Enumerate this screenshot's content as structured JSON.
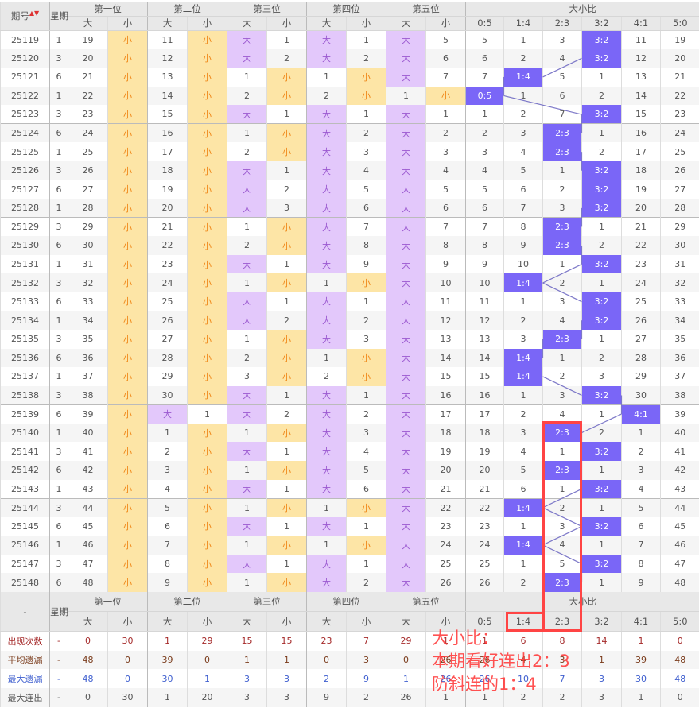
{
  "header": {
    "issue": "期号",
    "sort_icon": "sort-arrows",
    "weekday": "星期",
    "positions": [
      "第一位",
      "第二位",
      "第三位",
      "第四位",
      "第五位"
    ],
    "big": "大",
    "small": "小",
    "ratio_title": "大小比",
    "ratios": [
      "0:5",
      "1:4",
      "2:3",
      "3:2",
      "4:1",
      "5:0"
    ]
  },
  "rows": [
    [
      "25119",
      "1",
      "19",
      "小",
      "11",
      "小",
      "大",
      "1",
      "大",
      "1",
      "大",
      "5",
      "5",
      "1",
      "3",
      "3:2",
      "11",
      "19"
    ],
    [
      "25120",
      "3",
      "20",
      "小",
      "12",
      "小",
      "大",
      "2",
      "大",
      "2",
      "大",
      "6",
      "6",
      "2",
      "4",
      "3:2",
      "12",
      "20"
    ],
    [
      "25121",
      "6",
      "21",
      "小",
      "13",
      "小",
      "1",
      "小",
      "1",
      "小",
      "大",
      "7",
      "7",
      "1:4",
      "5",
      "1",
      "13",
      "21"
    ],
    [
      "25122",
      "1",
      "22",
      "小",
      "14",
      "小",
      "2",
      "小",
      "2",
      "小",
      "1",
      "小",
      "0:5",
      "1",
      "6",
      "2",
      "14",
      "22"
    ],
    [
      "25123",
      "3",
      "23",
      "小",
      "15",
      "小",
      "大",
      "1",
      "大",
      "1",
      "大",
      "1",
      "1",
      "2",
      "7",
      "3:2",
      "15",
      "23"
    ],
    [
      "25124",
      "6",
      "24",
      "小",
      "16",
      "小",
      "1",
      "小",
      "大",
      "2",
      "大",
      "2",
      "2",
      "3",
      "2:3",
      "1",
      "16",
      "24"
    ],
    [
      "25125",
      "1",
      "25",
      "小",
      "17",
      "小",
      "2",
      "小",
      "大",
      "3",
      "大",
      "3",
      "3",
      "4",
      "2:3",
      "2",
      "17",
      "25"
    ],
    [
      "25126",
      "3",
      "26",
      "小",
      "18",
      "小",
      "大",
      "1",
      "大",
      "4",
      "大",
      "4",
      "4",
      "5",
      "1",
      "3:2",
      "18",
      "26"
    ],
    [
      "25127",
      "6",
      "27",
      "小",
      "19",
      "小",
      "大",
      "2",
      "大",
      "5",
      "大",
      "5",
      "5",
      "6",
      "2",
      "3:2",
      "19",
      "27"
    ],
    [
      "25128",
      "1",
      "28",
      "小",
      "20",
      "小",
      "大",
      "3",
      "大",
      "6",
      "大",
      "6",
      "6",
      "7",
      "3",
      "3:2",
      "20",
      "28"
    ],
    [
      "25129",
      "3",
      "29",
      "小",
      "21",
      "小",
      "1",
      "小",
      "大",
      "7",
      "大",
      "7",
      "7",
      "8",
      "2:3",
      "1",
      "21",
      "29"
    ],
    [
      "25130",
      "6",
      "30",
      "小",
      "22",
      "小",
      "2",
      "小",
      "大",
      "8",
      "大",
      "8",
      "8",
      "9",
      "2:3",
      "2",
      "22",
      "30"
    ],
    [
      "25131",
      "1",
      "31",
      "小",
      "23",
      "小",
      "大",
      "1",
      "大",
      "9",
      "大",
      "9",
      "9",
      "10",
      "1",
      "3:2",
      "23",
      "31"
    ],
    [
      "25132",
      "3",
      "32",
      "小",
      "24",
      "小",
      "1",
      "小",
      "1",
      "小",
      "大",
      "10",
      "10",
      "1:4",
      "2",
      "1",
      "24",
      "32"
    ],
    [
      "25133",
      "6",
      "33",
      "小",
      "25",
      "小",
      "大",
      "1",
      "大",
      "1",
      "大",
      "11",
      "11",
      "1",
      "3",
      "3:2",
      "25",
      "33"
    ],
    [
      "25134",
      "1",
      "34",
      "小",
      "26",
      "小",
      "大",
      "2",
      "大",
      "2",
      "大",
      "12",
      "12",
      "2",
      "4",
      "3:2",
      "26",
      "34"
    ],
    [
      "25135",
      "3",
      "35",
      "小",
      "27",
      "小",
      "1",
      "小",
      "大",
      "3",
      "大",
      "13",
      "13",
      "3",
      "2:3",
      "1",
      "27",
      "35"
    ],
    [
      "25136",
      "6",
      "36",
      "小",
      "28",
      "小",
      "2",
      "小",
      "1",
      "小",
      "大",
      "14",
      "14",
      "1:4",
      "1",
      "2",
      "28",
      "36"
    ],
    [
      "25137",
      "1",
      "37",
      "小",
      "29",
      "小",
      "3",
      "小",
      "2",
      "小",
      "大",
      "15",
      "15",
      "1:4",
      "2",
      "3",
      "29",
      "37"
    ],
    [
      "25138",
      "3",
      "38",
      "小",
      "30",
      "小",
      "大",
      "1",
      "大",
      "1",
      "大",
      "16",
      "16",
      "1",
      "3",
      "3:2",
      "30",
      "38"
    ],
    [
      "25139",
      "6",
      "39",
      "小",
      "大",
      "1",
      "大",
      "2",
      "大",
      "2",
      "大",
      "17",
      "17",
      "2",
      "4",
      "1",
      "4:1",
      "39"
    ],
    [
      "25140",
      "1",
      "40",
      "小",
      "1",
      "小",
      "1",
      "小",
      "大",
      "3",
      "大",
      "18",
      "18",
      "3",
      "2:3",
      "2",
      "1",
      "40"
    ],
    [
      "25141",
      "3",
      "41",
      "小",
      "2",
      "小",
      "大",
      "1",
      "大",
      "4",
      "大",
      "19",
      "19",
      "4",
      "1",
      "3:2",
      "2",
      "41"
    ],
    [
      "25142",
      "6",
      "42",
      "小",
      "3",
      "小",
      "1",
      "小",
      "大",
      "5",
      "大",
      "20",
      "20",
      "5",
      "2:3",
      "1",
      "3",
      "42"
    ],
    [
      "25143",
      "1",
      "43",
      "小",
      "4",
      "小",
      "大",
      "1",
      "大",
      "6",
      "大",
      "21",
      "21",
      "6",
      "1",
      "3:2",
      "4",
      "43"
    ],
    [
      "25144",
      "3",
      "44",
      "小",
      "5",
      "小",
      "1",
      "小",
      "1",
      "小",
      "大",
      "22",
      "22",
      "1:4",
      "2",
      "1",
      "5",
      "44"
    ],
    [
      "25145",
      "6",
      "45",
      "小",
      "6",
      "小",
      "大",
      "1",
      "大",
      "1",
      "大",
      "23",
      "23",
      "1",
      "3",
      "3:2",
      "6",
      "45"
    ],
    [
      "25146",
      "1",
      "46",
      "小",
      "7",
      "小",
      "1",
      "小",
      "1",
      "小",
      "大",
      "24",
      "24",
      "1:4",
      "4",
      "1",
      "7",
      "46"
    ],
    [
      "25147",
      "3",
      "47",
      "小",
      "8",
      "小",
      "大",
      "1",
      "大",
      "1",
      "大",
      "25",
      "25",
      "1",
      "5",
      "3:2",
      "8",
      "47"
    ],
    [
      "25148",
      "6",
      "48",
      "小",
      "9",
      "小",
      "1",
      "小",
      "大",
      "2",
      "大",
      "26",
      "26",
      "2",
      "2:3",
      "1",
      "9",
      "48"
    ]
  ],
  "footer_header": {
    "dash": "-"
  },
  "stats": [
    {
      "label": "出现次数",
      "values": [
        "-",
        "0",
        "30",
        "1",
        "29",
        "15",
        "15",
        "23",
        "7",
        "29",
        "1",
        "1",
        "6",
        "8",
        "14",
        "1",
        "0"
      ]
    },
    {
      "label": "平均遗漏",
      "values": [
        "-",
        "48",
        "0",
        "39",
        "0",
        "1",
        "1",
        "0",
        "3",
        "0",
        "26",
        "26",
        "4",
        "3",
        "1",
        "39",
        "48"
      ]
    },
    {
      "label": "最大遗漏",
      "values": [
        "-",
        "48",
        "0",
        "30",
        "1",
        "3",
        "3",
        "2",
        "9",
        "1",
        "26",
        "26",
        "10",
        "7",
        "3",
        "30",
        "48"
      ]
    },
    {
      "label": "最大连出",
      "values": [
        "-",
        "0",
        "30",
        "1",
        "20",
        "3",
        "3",
        "9",
        "2",
        "26",
        "1",
        "1",
        "2",
        "2",
        "3",
        "1",
        "0"
      ]
    }
  ],
  "annotation": {
    "lines": [
      "大小比：",
      "本期看好连出2：3",
      "防斜连的1：4"
    ]
  },
  "colors": {
    "small_bg": "#fde5a6",
    "big_bg": "#e3c8fb",
    "hit": "#7a66f7",
    "annotation": "#ff4444"
  }
}
